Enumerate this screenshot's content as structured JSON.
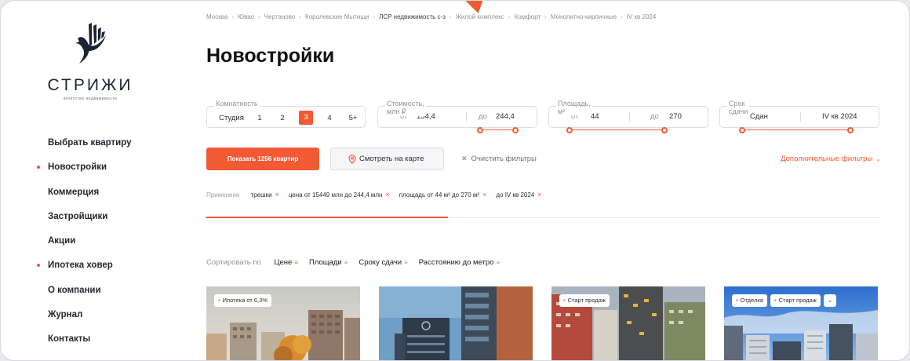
{
  "logo": {
    "name": "СТРИЖИ",
    "subtitle": "агентство недвижимости"
  },
  "nav": [
    {
      "label": "Выбрать квартиру",
      "dot": false
    },
    {
      "label": "Новостройки",
      "dot": true
    },
    {
      "label": "Коммерция",
      "dot": false
    },
    {
      "label": "Застройщики",
      "dot": false
    },
    {
      "label": "Акции",
      "dot": false
    },
    {
      "label": "Ипотека ховер",
      "dot": true
    },
    {
      "label": "О компании",
      "dot": false
    },
    {
      "label": "Журнал",
      "dot": false
    },
    {
      "label": "Контакты",
      "dot": false
    }
  ],
  "breadcrumbs": [
    "Москва",
    "Ювао",
    "Чертаново",
    "Королевские Мытищи",
    "ЛСР недвижимость с-з",
    "Жилой комплекс",
    "Комфорт",
    "Монолитно-кирпичные",
    "IV кв 2024"
  ],
  "page_title": "Новостройки",
  "filters": {
    "rooms": {
      "label": "Комнатность",
      "options": [
        "Студия",
        "1",
        "2",
        "3",
        "4",
        "5+"
      ],
      "selected": "3"
    },
    "price": {
      "label": "Стоимость, млн ₽",
      "from_label": "от",
      "from": "154,4",
      "to_label": "до",
      "to": "244,4"
    },
    "area": {
      "label": "Площадь, м²",
      "from_label": "от",
      "from": "44",
      "to_label": "до",
      "to": "270"
    },
    "deadline": {
      "label": "Срок сдачи",
      "from": "Сдан",
      "to": "IV кв 2024"
    }
  },
  "actions": {
    "show": "Показать 1256 квартир",
    "map": "Смотреть на карте",
    "clear": "Очистить фильтры",
    "more": "Дополнительные фильтры"
  },
  "applied": {
    "label": "Применено",
    "tags": [
      "трешки",
      "цена от 15449 млн до 244,4 млн",
      "площадь от 44 м² до 270 м²",
      "до IV кв 2024"
    ]
  },
  "sort": {
    "label": "Сортировать по",
    "options": [
      "Цене",
      "Площади",
      "Сроку сдачи",
      "Расстоянию до метро"
    ],
    "active": "Цене"
  },
  "cards": [
    {
      "badges": [
        "Ипотека от 6,3%"
      ]
    },
    {
      "badges": []
    },
    {
      "badges": [
        "Старт продаж"
      ]
    },
    {
      "badges": [
        "Отделка",
        "Старт продаж"
      ]
    }
  ],
  "colors": {
    "accent": "#f25a33",
    "text": "#1a1a1f",
    "muted": "#8e929a"
  }
}
